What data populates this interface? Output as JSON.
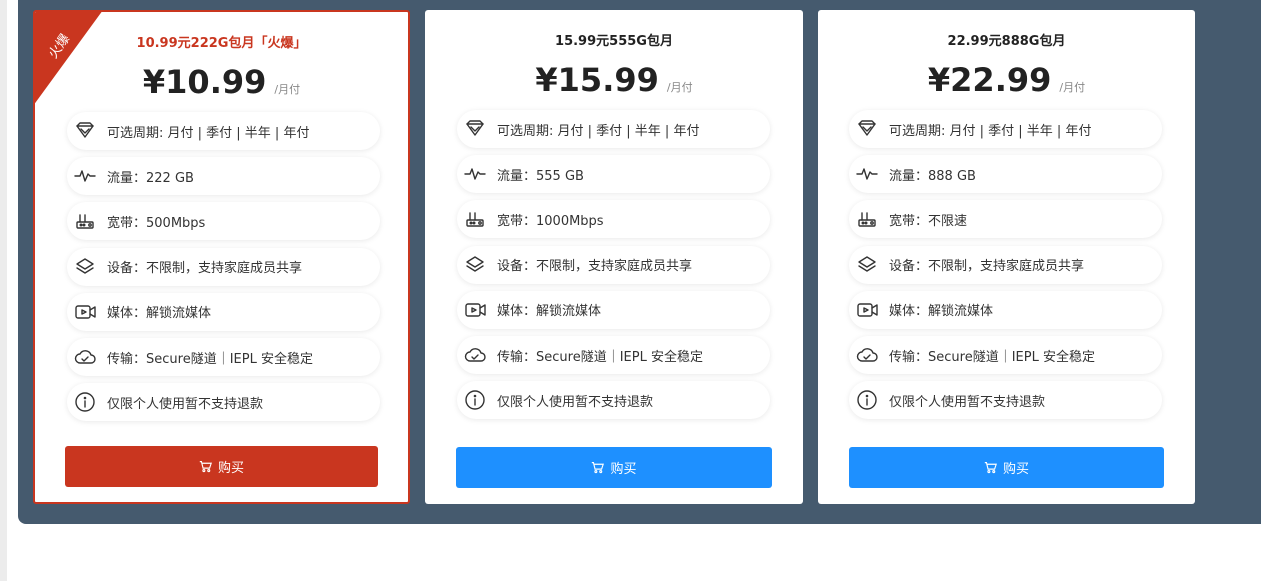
{
  "colors": {
    "accent_hot": "#c9361f",
    "accent_blue": "#1e90ff",
    "panel_bg": "#455a6e"
  },
  "plans": [
    {
      "title": "10.99元222G包月「火爆」",
      "price": "¥10.99",
      "unit": "/月付",
      "badge": "火爆",
      "features": [
        {
          "icon": "diamond-icon",
          "text": "可选周期: 月付 | 季付 | 半年 | 年付"
        },
        {
          "icon": "pulse-icon",
          "text": "流量：222 GB"
        },
        {
          "icon": "router-icon",
          "text": "宽带：500Mbps"
        },
        {
          "icon": "layers-icon",
          "text": "设备：不限制，支持家庭成员共享"
        },
        {
          "icon": "video-icon",
          "text": "媒体：解锁流媒体"
        },
        {
          "icon": "cloud-icon",
          "text": "传输：Secure隧道｜IEPL 安全稳定"
        },
        {
          "icon": "info-icon",
          "text": "仅限个人使用暂不支持退款"
        }
      ],
      "button": "购买"
    },
    {
      "title": "15.99元555G包月",
      "price": "¥15.99",
      "unit": "/月付",
      "features": [
        {
          "icon": "diamond-icon",
          "text": "可选周期: 月付 | 季付 | 半年 | 年付"
        },
        {
          "icon": "pulse-icon",
          "text": "流量：555 GB"
        },
        {
          "icon": "router-icon",
          "text": "宽带：1000Mbps"
        },
        {
          "icon": "layers-icon",
          "text": "设备：不限制，支持家庭成员共享"
        },
        {
          "icon": "video-icon",
          "text": "媒体：解锁流媒体"
        },
        {
          "icon": "cloud-icon",
          "text": "传输：Secure隧道｜IEPL 安全稳定"
        },
        {
          "icon": "info-icon",
          "text": "仅限个人使用暂不支持退款"
        }
      ],
      "button": "购买"
    },
    {
      "title": "22.99元888G包月",
      "price": "¥22.99",
      "unit": "/月付",
      "features": [
        {
          "icon": "diamond-icon",
          "text": "可选周期: 月付 | 季付 | 半年 | 年付"
        },
        {
          "icon": "pulse-icon",
          "text": "流量：888 GB"
        },
        {
          "icon": "router-icon",
          "text": "宽带：不限速"
        },
        {
          "icon": "layers-icon",
          "text": "设备：不限制，支持家庭成员共享"
        },
        {
          "icon": "video-icon",
          "text": "媒体：解锁流媒体"
        },
        {
          "icon": "cloud-icon",
          "text": "传输：Secure隧道｜IEPL 安全稳定"
        },
        {
          "icon": "info-icon",
          "text": "仅限个人使用暂不支持退款"
        }
      ],
      "button": "购买"
    }
  ]
}
